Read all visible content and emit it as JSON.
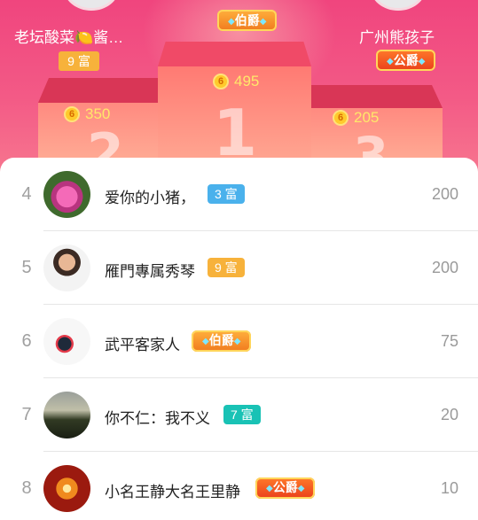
{
  "podium": {
    "first": {
      "crown": "伯爵",
      "score": "495",
      "place": "1"
    },
    "second": {
      "name": "老坛酸菜🍋酱…",
      "badge": "9 富",
      "score": "350",
      "place": "2"
    },
    "third": {
      "name": "广州熊孩子",
      "crown": "公爵",
      "score": "205",
      "place": "3"
    },
    "coin_glyph": "6"
  },
  "rows": [
    {
      "rank": "4",
      "name": "爱你的小猪，",
      "tag": "3 富",
      "tag_color": "#4ab1ec",
      "value": "200",
      "avatar": "lotus-avatar"
    },
    {
      "rank": "5",
      "name": "雁門專属秀琴",
      "tag": "9 富",
      "tag_color": "#f7b23b",
      "value": "200",
      "avatar": "girl-avatar"
    },
    {
      "rank": "6",
      "name": "武平客家人",
      "tag": "伯爵",
      "tag_color": "#f07a1e",
      "value": "75",
      "avatar": "art-avatar"
    },
    {
      "rank": "7",
      "name": "你不仁：我不义",
      "tag": "7 富",
      "tag_color": "#19c2b5",
      "value": "20",
      "avatar": "sunset-avatar"
    },
    {
      "rank": "8",
      "name": "小名王静大名王里静",
      "tag": "公爵",
      "tag_color": "#ea3f1b",
      "value": "10",
      "avatar": "fire-avatar"
    }
  ]
}
